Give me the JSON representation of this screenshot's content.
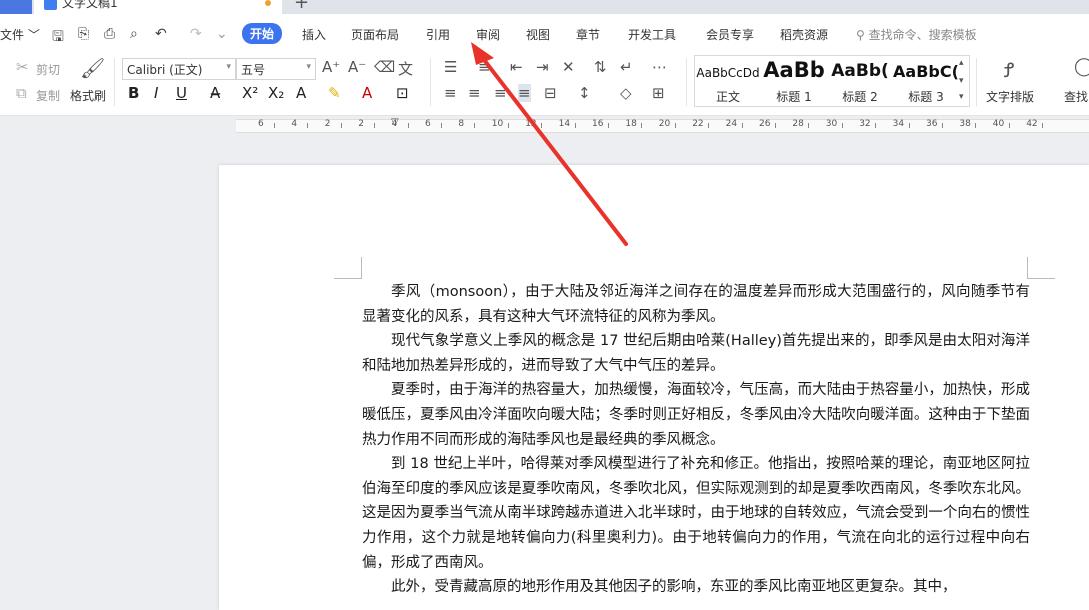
{
  "tabbar": {
    "doc_title": "文字文稿1"
  },
  "menubar": {
    "file": "文件",
    "tabs": [
      "开始",
      "插入",
      "页面布局",
      "引用",
      "审阅",
      "视图",
      "章节",
      "开发工具",
      "会员专享",
      "稻壳资源"
    ],
    "active_tab": "开始",
    "search_placeholder": "查找命令、搜索模板"
  },
  "ribbon": {
    "cut": "剪切",
    "copy": "复制",
    "format_painter": "格式刷",
    "font_name": "Calibri (正文)",
    "font_size": "五号",
    "styles": [
      {
        "preview": "AaBbCcDd",
        "label": "正文"
      },
      {
        "preview": "AaBb",
        "label": "标题 1"
      },
      {
        "preview": "AaBb(",
        "label": "标题 2"
      },
      {
        "preview": "AaBbC(",
        "label": "标题 3"
      }
    ],
    "text_layout": "文字排版",
    "find": "查找"
  },
  "ruler": {
    "labels": [
      "6",
      "4",
      "2",
      "2",
      "4",
      "6",
      "8",
      "10",
      "12",
      "14",
      "16",
      "18",
      "20",
      "22",
      "24",
      "26",
      "28",
      "30",
      "32",
      "34",
      "36",
      "38",
      "40",
      "42"
    ]
  },
  "document": {
    "paragraphs": [
      "季风（monsoon），由于大陆及邻近海洋之间存在的温度差异而形成大范围盛行的，风向随季节有显著变化的风系，具有这种大气环流特征的风称为季风。",
      "现代气象学意义上季风的概念是 17 世纪后期由哈莱(Halley)首先提出来的，即季风是由太阳对海洋和陆地加热差异形成的，进而导致了大气中气压的差异。",
      "夏季时，由于海洋的热容量大，加热缓慢，海面较冷，气压高，而大陆由于热容量小，加热快，形成暖低压，夏季风由冷洋面吹向暖大陆；冬季时则正好相反，冬季风由冷大陆吹向暖洋面。这种由于下垫面热力作用不同而形成的海陆季风也是最经典的季风概念。",
      "到 18 世纪上半叶，哈得莱对季风模型进行了补充和修正。他指出，按照哈莱的理论，南亚地区阿拉伯海至印度的季风应该是夏季吹南风，冬季吹北风，但实际观测到的却是夏季吹西南风，冬季吹东北风。这是因为夏季当气流从南半球跨越赤道进入北半球时，由于地球的自转效应，气流会受到一个向右的惯性力作用，这个力就是地转偏向力(科里奥利力)。由于地转偏向力的作用，气流在向北的运行过程中向右偏，形成了西南风。",
      "此外，受青藏高原的地形作用及其他因子的影响，东亚的季风比南亚地区更复杂。其中，"
    ]
  },
  "colors": {
    "accent": "#3b74ee",
    "arrow": "#e8322a"
  }
}
